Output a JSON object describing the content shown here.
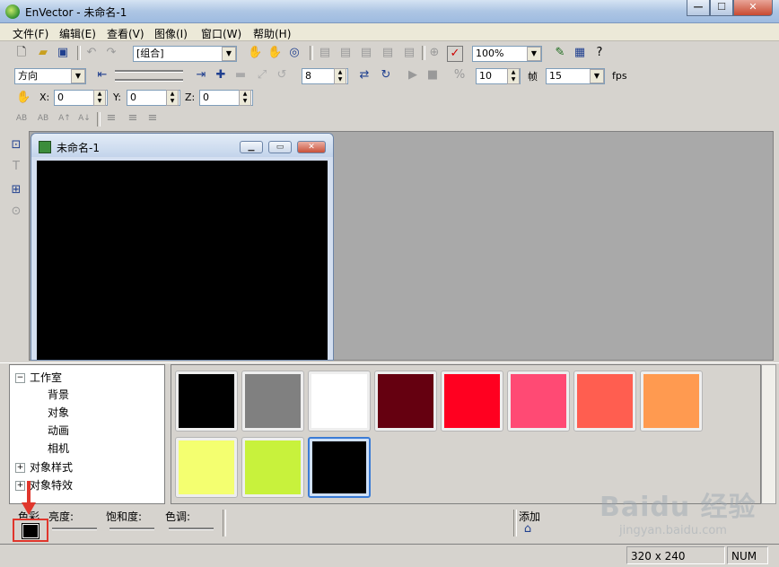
{
  "window": {
    "title": "EnVector - 未命名-1",
    "min": "0",
    "max": "1",
    "close": "r"
  },
  "menu": [
    "文件(F)",
    "编辑(E)",
    "查看(V)",
    "图像(I)",
    "窗口(W)",
    "帮助(H)"
  ],
  "toolbar1": {
    "group_select": "[组合]",
    "zoom": "100%"
  },
  "toolbar2": {
    "direction": "方向",
    "frame_step": "8",
    "speed": "10",
    "frame_label": "帧",
    "fps_value": "15",
    "fps_unit": "fps"
  },
  "toolbar3": {
    "x_label": "X:",
    "x_value": "0",
    "y_label": "Y:",
    "y_value": "0",
    "z_label": "Z:",
    "z_value": "0"
  },
  "toolbar4": {
    "text_icons": [
      "AB",
      "AB",
      "A↑",
      "A↓"
    ]
  },
  "document": {
    "title": "未命名-1"
  },
  "tree": {
    "root": "工作室",
    "children": [
      "背景",
      "对象",
      "动画",
      "相机"
    ],
    "others": [
      "对象样式",
      "对象特效"
    ],
    "box_expanded": "−",
    "box_collapsed": "+"
  },
  "swatches": [
    {
      "color": "#000000"
    },
    {
      "color": "#808080"
    },
    {
      "color": "#ffffff"
    },
    {
      "color": "#650010"
    },
    {
      "color": "#ff0020"
    },
    {
      "color": "#ff4a74"
    },
    {
      "color": "#ff5e50"
    },
    {
      "color": "#ff9a50"
    },
    {
      "color": "#f4ff70"
    },
    {
      "color": "#c8f23c"
    },
    {
      "color": "#000000",
      "selected": true
    }
  ],
  "controls": {
    "color_label": "色彩",
    "brightness_label": "亮度:",
    "saturation_label": "饱和度:",
    "hue_label": "色调:",
    "add_label": "添加",
    "current_color": "#000000"
  },
  "status": {
    "size": "320 x 240",
    "num": "NUM"
  },
  "watermark": {
    "main": "Baidu 经验",
    "sub": "jingyan.baidu.com"
  }
}
